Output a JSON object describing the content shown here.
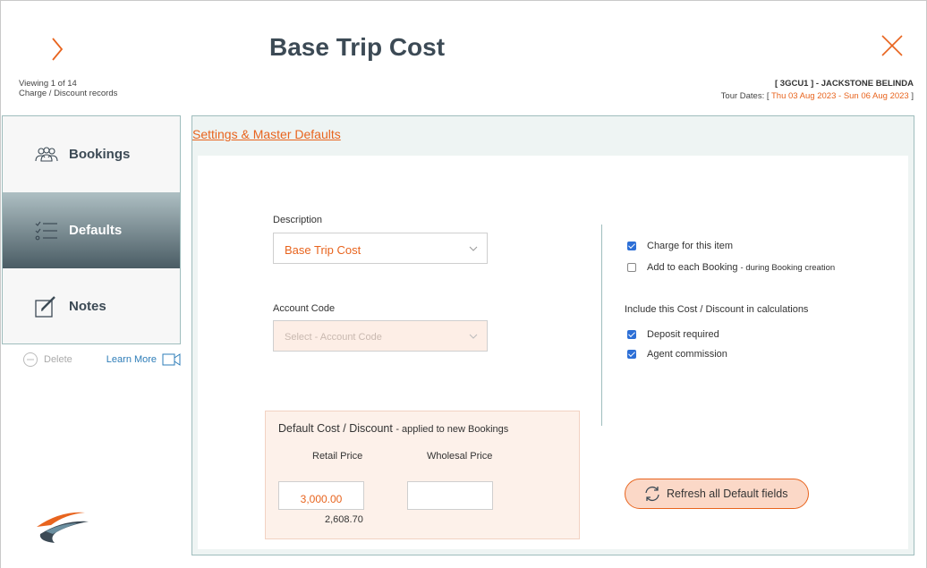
{
  "header": {
    "title": "Base Trip Cost",
    "viewing_line1": "Viewing 1 of 14",
    "viewing_line2": "Charge / Discount records",
    "trip_code": "[ 3GCU1 ] - JACKSTONE BELINDA",
    "tour_dates_prefix": "Tour Dates: [",
    "tour_start": "Thu 03 Aug 2023",
    "tour_sep": "-",
    "tour_end": "Sun 06 Aug 2023",
    "tour_suffix": "]"
  },
  "sidebar": {
    "items": [
      {
        "label": "Bookings",
        "icon": "people-icon",
        "active": false
      },
      {
        "label": "Defaults",
        "icon": "checklist-icon",
        "active": true
      },
      {
        "label": "Notes",
        "icon": "edit-note-icon",
        "active": false
      }
    ],
    "delete_label": "Delete",
    "learn_more_label": "Learn More"
  },
  "main": {
    "section_link": "Settings & Master Defaults",
    "description_label": "Description",
    "description_value": "Base Trip Cost",
    "account_code_label": "Account Code",
    "account_code_placeholder": "Select - Account Code",
    "checkboxes": {
      "charge": {
        "label": "Charge for this item",
        "checked": true
      },
      "add_each": {
        "label": "Add to each Booking",
        "note": "- during Booking creation",
        "checked": false
      },
      "calc_label": "Include this Cost / Discount in calculations",
      "deposit": {
        "label": "Deposit required",
        "checked": true
      },
      "agent": {
        "label": "Agent commission",
        "checked": true
      }
    },
    "cost": {
      "title": "Default Cost / Discount",
      "title_note": "- applied to new Bookings",
      "retail_label": "Retail Price",
      "wholesale_label": "Wholesal Price",
      "retail_value": "3,000.00",
      "wholesale_value": "",
      "retail_sub": "2,608.70"
    },
    "refresh_label": "Refresh all Default fields"
  },
  "colors": {
    "accent": "#e8641e",
    "title": "#3c4a55",
    "border": "#9fbdbd",
    "check": "#2d6fd6"
  }
}
